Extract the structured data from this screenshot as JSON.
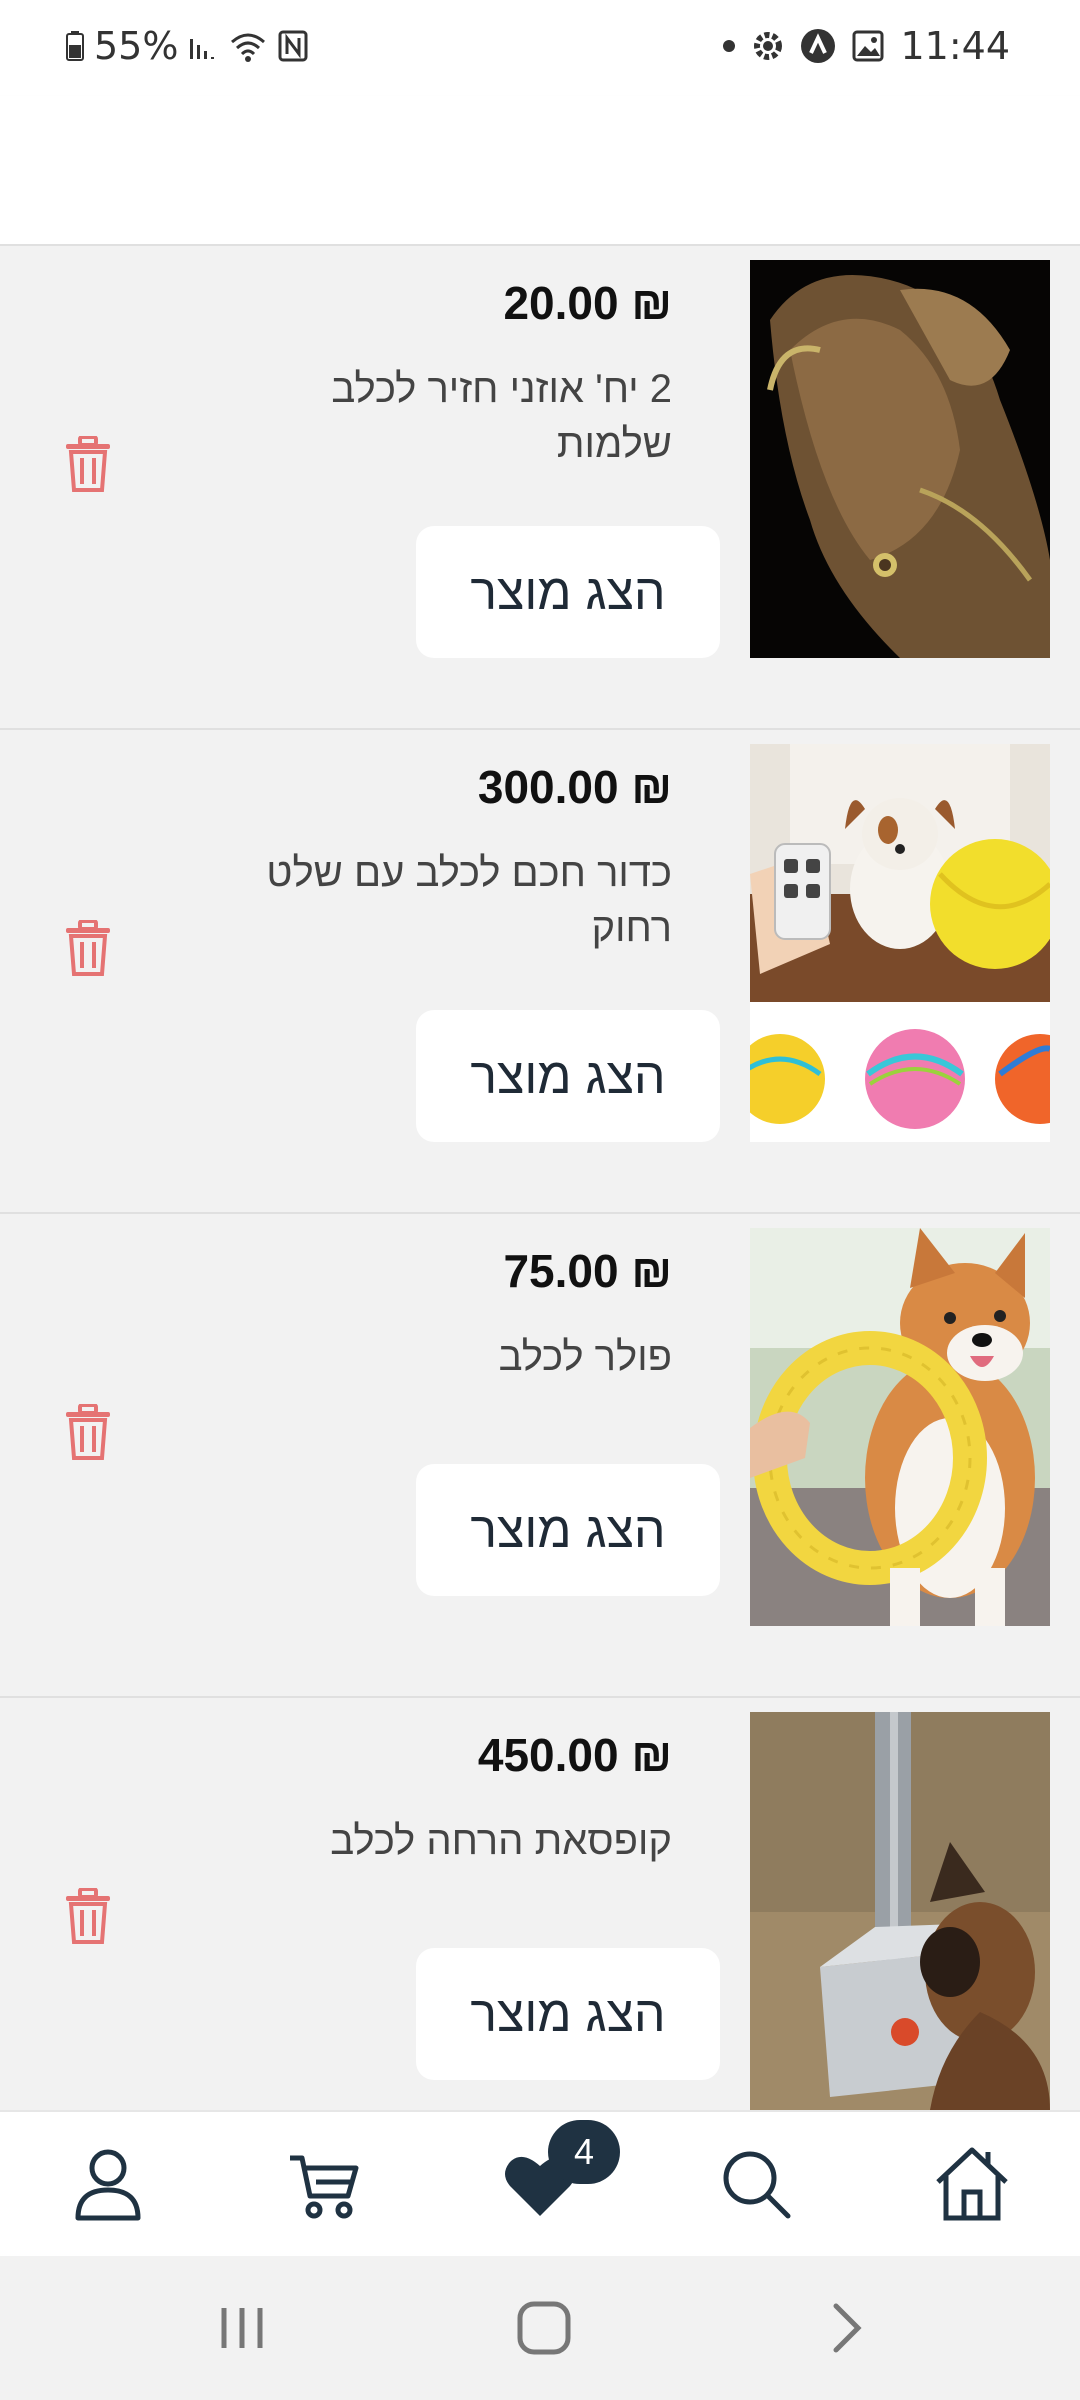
{
  "status_bar": {
    "battery": "55%",
    "time": "11:44",
    "icons": [
      "battery-icon",
      "signal-icon",
      "wifi-icon",
      "nfc-icon",
      "dot-icon",
      "settings-icon",
      "app-icon",
      "gallery-icon"
    ]
  },
  "wishlist": {
    "items": [
      {
        "price": "20.00 ₪",
        "name": "2 יח' אוזני חזיר לכלב שלמות",
        "button": "הצג מוצר",
        "image": "pig-ears"
      },
      {
        "price": "300.00 ₪",
        "name": "כדור חכם לכלב עם שלט רחוק",
        "button": "הצג מוצר",
        "image": "smart-ball"
      },
      {
        "price": "75.00 ₪",
        "name": "פולר לכלב",
        "button": "הצג מוצר",
        "image": "puller-ring"
      },
      {
        "price": "450.00 ₪",
        "name": "קופסאת הרחה לכלב",
        "button": "הצג מוצר",
        "image": "sniff-box"
      }
    ]
  },
  "bottom_nav": {
    "items": [
      "profile-icon",
      "cart-icon",
      "heart-icon",
      "search-icon",
      "home-icon"
    ],
    "wishlist_count": "4"
  },
  "colors": {
    "accent": "#1f3242",
    "trash": "#e57373",
    "background": "#f2f2f2"
  }
}
